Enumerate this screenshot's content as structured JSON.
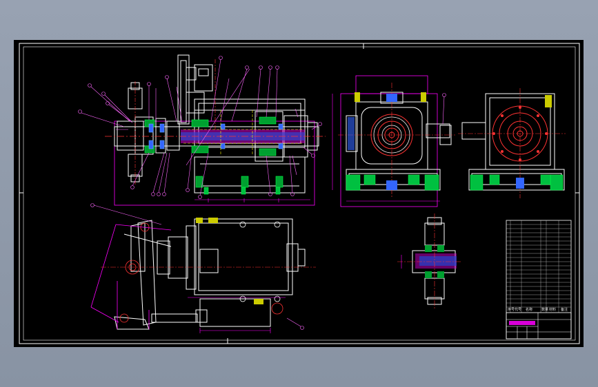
{
  "drawing": {
    "background": "#000000",
    "colors": {
      "frame": "#ffffff",
      "outline": "#ffffff",
      "dimension": "#ff00ff",
      "centerline": "#ff3333",
      "hidden": "#ffff00",
      "hatch": "#00cc33",
      "fastener": "#3399ff",
      "leader": "#ff66ff"
    }
  },
  "views": [
    {
      "name": "main-section-view"
    },
    {
      "name": "side-view-left"
    },
    {
      "name": "side-view-right"
    },
    {
      "name": "plan-view"
    },
    {
      "name": "detail-view"
    }
  ],
  "title_block": {
    "header_labels": [
      "序号",
      "代号",
      "名称",
      "数量",
      "材料",
      "备注"
    ],
    "drawing_title": "",
    "scale": ""
  }
}
